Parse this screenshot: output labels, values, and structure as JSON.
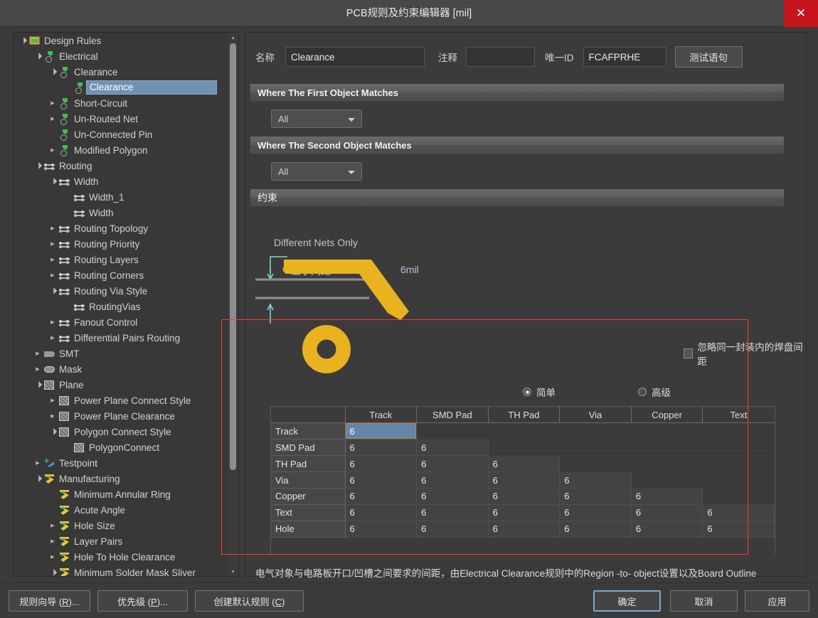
{
  "window": {
    "title": "PCB规则及约束编辑器 [mil]",
    "close_icon": "close-icon",
    "close_label": "✕"
  },
  "tree": {
    "items": [
      {
        "label": "Design Rules",
        "depth": 0,
        "twisty": "open",
        "icon": "folder-rules-icon"
      },
      {
        "label": "Electrical",
        "depth": 1,
        "twisty": "open",
        "icon": "electrical-icon"
      },
      {
        "label": "Clearance",
        "depth": 2,
        "twisty": "open",
        "icon": "electrical-icon"
      },
      {
        "label": "Clearance",
        "depth": 3,
        "twisty": "none",
        "icon": "electrical-icon",
        "selected": true
      },
      {
        "label": "Short-Circuit",
        "depth": 2,
        "twisty": "closed",
        "icon": "electrical-icon"
      },
      {
        "label": "Un-Routed Net",
        "depth": 2,
        "twisty": "closed",
        "icon": "electrical-icon"
      },
      {
        "label": "Un-Connected Pin",
        "depth": 2,
        "twisty": "none",
        "icon": "electrical-icon"
      },
      {
        "label": "Modified Polygon",
        "depth": 2,
        "twisty": "closed",
        "icon": "electrical-icon"
      },
      {
        "label": "Routing",
        "depth": 1,
        "twisty": "open",
        "icon": "routing-icon"
      },
      {
        "label": "Width",
        "depth": 2,
        "twisty": "open",
        "icon": "routing-icon"
      },
      {
        "label": "Width_1",
        "depth": 3,
        "twisty": "none",
        "icon": "routing-icon"
      },
      {
        "label": "Width",
        "depth": 3,
        "twisty": "none",
        "icon": "routing-icon"
      },
      {
        "label": "Routing Topology",
        "depth": 2,
        "twisty": "closed",
        "icon": "routing-icon"
      },
      {
        "label": "Routing Priority",
        "depth": 2,
        "twisty": "closed",
        "icon": "routing-icon"
      },
      {
        "label": "Routing Layers",
        "depth": 2,
        "twisty": "closed",
        "icon": "routing-icon"
      },
      {
        "label": "Routing Corners",
        "depth": 2,
        "twisty": "closed",
        "icon": "routing-icon"
      },
      {
        "label": "Routing Via Style",
        "depth": 2,
        "twisty": "open",
        "icon": "routing-icon"
      },
      {
        "label": "RoutingVias",
        "depth": 3,
        "twisty": "none",
        "icon": "routing-icon"
      },
      {
        "label": "Fanout Control",
        "depth": 2,
        "twisty": "closed",
        "icon": "routing-icon"
      },
      {
        "label": "Differential Pairs Routing",
        "depth": 2,
        "twisty": "closed",
        "icon": "routing-icon"
      },
      {
        "label": "SMT",
        "depth": 1,
        "twisty": "closed",
        "icon": "smt-icon"
      },
      {
        "label": "Mask",
        "depth": 1,
        "twisty": "closed",
        "icon": "mask-icon"
      },
      {
        "label": "Plane",
        "depth": 1,
        "twisty": "open",
        "icon": "plane-icon"
      },
      {
        "label": "Power Plane Connect Style",
        "depth": 2,
        "twisty": "closed",
        "icon": "plane-icon"
      },
      {
        "label": "Power Plane Clearance",
        "depth": 2,
        "twisty": "closed",
        "icon": "plane-icon"
      },
      {
        "label": "Polygon Connect Style",
        "depth": 2,
        "twisty": "open",
        "icon": "plane-icon"
      },
      {
        "label": "PolygonConnect",
        "depth": 3,
        "twisty": "none",
        "icon": "plane-icon"
      },
      {
        "label": "Testpoint",
        "depth": 1,
        "twisty": "closed",
        "icon": "testpoint-icon"
      },
      {
        "label": "Manufacturing",
        "depth": 1,
        "twisty": "open",
        "icon": "manufacturing-icon"
      },
      {
        "label": "Minimum Annular Ring",
        "depth": 2,
        "twisty": "none",
        "icon": "manufacturing-icon"
      },
      {
        "label": "Acute Angle",
        "depth": 2,
        "twisty": "none",
        "icon": "manufacturing-icon"
      },
      {
        "label": "Hole Size",
        "depth": 2,
        "twisty": "closed",
        "icon": "manufacturing-icon"
      },
      {
        "label": "Layer Pairs",
        "depth": 2,
        "twisty": "closed",
        "icon": "manufacturing-icon"
      },
      {
        "label": "Hole To Hole Clearance",
        "depth": 2,
        "twisty": "closed",
        "icon": "manufacturing-icon"
      },
      {
        "label": "Minimum Solder Mask Sliver",
        "depth": 2,
        "twisty": "open",
        "icon": "manufacturing-icon"
      }
    ],
    "scrollbar": {
      "up_icon": "scroll-up-icon",
      "down_icon": "scroll-down-icon",
      "up_glyph": "▲",
      "down_glyph": "▼"
    }
  },
  "header": {
    "name_label": "名称",
    "name_value": "Clearance",
    "comment_label": "注释",
    "comment_value": "",
    "unique_id_label": "唯一ID",
    "unique_id_value": "FCAFPRHE",
    "test_query_button": "测试语句"
  },
  "sections": {
    "first_object": {
      "title": "Where The First Object Matches",
      "scope_value": "All"
    },
    "second_object": {
      "title": "Where The Second Object Matches",
      "scope_value": "All"
    },
    "constraints": {
      "title": "约束"
    }
  },
  "constraint": {
    "different_nets_only": "Different Nets Only",
    "min_clearance_label": "最小间距",
    "min_clearance_value": "6mil",
    "ignore_pad_checkbox": "忽略同一封装内的焊盘间距",
    "ignore_pad_checked": false,
    "mode_simple": "简单",
    "mode_advanced": "高级",
    "mode_selected": "简单"
  },
  "matrix": {
    "columns": [
      "Track",
      "SMD Pad",
      "TH Pad",
      "Via",
      "Copper",
      "Text"
    ],
    "rows": [
      {
        "label": "Track",
        "values": [
          "6",
          "",
          "",
          "",
          "",
          ""
        ]
      },
      {
        "label": "SMD Pad",
        "values": [
          "6",
          "6",
          "",
          "",
          "",
          ""
        ]
      },
      {
        "label": "TH Pad",
        "values": [
          "6",
          "6",
          "6",
          "",
          "",
          ""
        ]
      },
      {
        "label": "Via",
        "values": [
          "6",
          "6",
          "6",
          "6",
          "",
          ""
        ]
      },
      {
        "label": "Copper",
        "values": [
          "6",
          "6",
          "6",
          "6",
          "6",
          ""
        ]
      },
      {
        "label": "Text",
        "values": [
          "6",
          "6",
          "6",
          "6",
          "6",
          "6"
        ]
      },
      {
        "label": "Hole",
        "values": [
          "6",
          "6",
          "6",
          "6",
          "6",
          "6"
        ]
      }
    ],
    "selected_cell": {
      "row": 0,
      "col": 0
    }
  },
  "description": "电气对象与电路板开口/凹槽之间要求的间距，由Electrical Clearance规则中的Region -to- object设置以及Board Outline Clearance规则设置中的最大值决定.",
  "footer": {
    "left_buttons": [
      {
        "text_before": "规则向导 (",
        "accel": "R",
        "text_after": ")..."
      },
      {
        "text_before": "优先级 (",
        "accel": "P",
        "text_after": ")..."
      },
      {
        "text_before": "创建默认规则 (",
        "accel": "C",
        "text_after": ")"
      }
    ],
    "ok": "确定",
    "cancel": "取消",
    "apply": "应用"
  },
  "colors": {
    "accent_selection": "#6386a8",
    "red_highlight": "#ff3b30",
    "copper": "#e8b31e",
    "close_red": "#c5141b"
  }
}
